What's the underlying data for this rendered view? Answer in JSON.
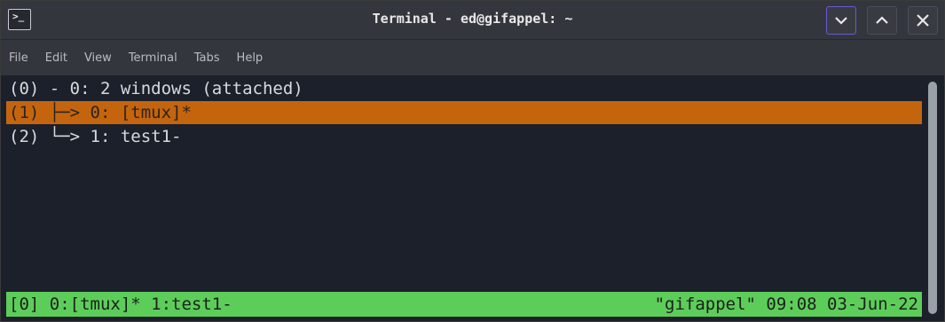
{
  "window": {
    "title": "Terminal - ed@gifappel: ~",
    "app_icon": "terminal-icon",
    "app_icon_glyph": ">_",
    "controls": [
      "minimize-icon",
      "maximize-icon",
      "close-icon"
    ]
  },
  "menu": {
    "items": [
      "File",
      "Edit",
      "View",
      "Terminal",
      "Tabs",
      "Help"
    ]
  },
  "terminal": {
    "lines": [
      {
        "index": "(0)",
        "text": " - 0: 2 windows (attached)"
      },
      {
        "index": "(1)",
        "text": " ├─> 0: [tmux]*",
        "selected": true
      },
      {
        "index": "(2)",
        "text": " └─> 1: test1-"
      }
    ],
    "status": {
      "left": "[0] 0:[tmux]* 1:test1-",
      "right": "\"gifappel\" 09:08 03-Jun-22"
    }
  },
  "colors": {
    "selection": "#c4650e",
    "statusbar": "#5dcd5a",
    "background": "#1b202a"
  }
}
